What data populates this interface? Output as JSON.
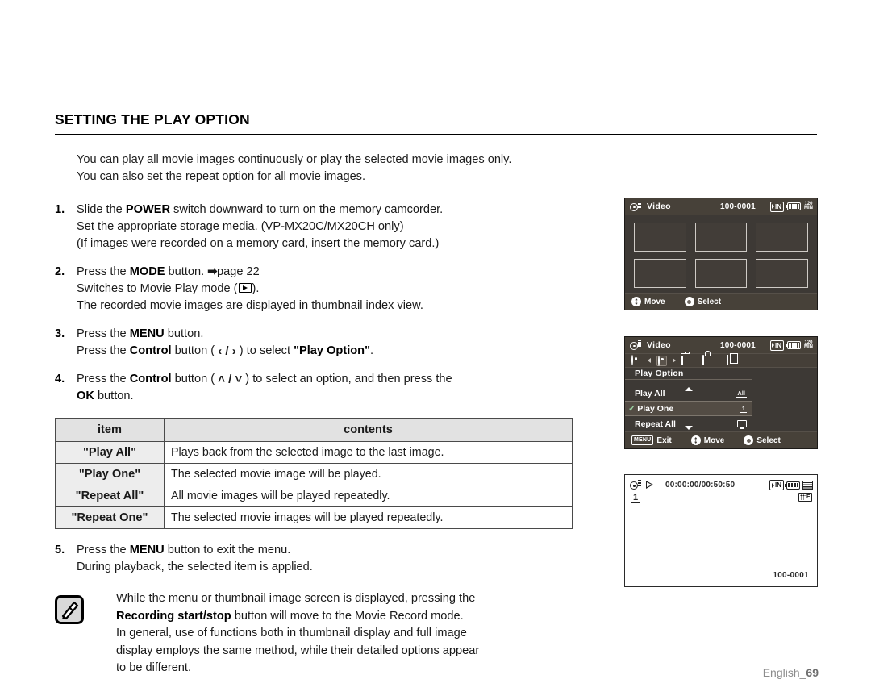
{
  "section": {
    "title": "SETTING THE PLAY OPTION",
    "intro_line1": "You can play all movie images continuously or play the selected movie images only.",
    "intro_line2": "You can also set the repeat option for all movie images."
  },
  "steps": [
    {
      "num": "1.",
      "lead_a": "Slide the ",
      "lead_bold": "POWER",
      "lead_b": " switch downward to turn on the memory camcorder.",
      "sub1": "Set the appropriate storage media. (VP-MX20C/MX20CH only)",
      "sub2": "(If images were recorded on a memory card, insert the memory card.)"
    },
    {
      "num": "2.",
      "lead_a": "Press the ",
      "lead_bold": "MODE",
      "lead_b": " button. ",
      "page_ref": "page 22",
      "sub1_a": "Switches to Movie Play mode (",
      "sub1_b": ").",
      "sub2": "The recorded movie images are displayed in thumbnail index view."
    },
    {
      "num": "3.",
      "lead_a": "Press the ",
      "lead_bold": "MENU",
      "lead_b": " button.",
      "sub1_a": "Press the ",
      "sub1_bold": "Control",
      "sub1_b": " button ( ",
      "sub1_arrows": "‹ / ›",
      "sub1_c": " ) to select ",
      "sub1_target": "\"Play Option\"",
      "sub1_d": "."
    },
    {
      "num": "4.",
      "lead_a": "Press the ",
      "lead_bold": "Control",
      "lead_b": " button ( ",
      "lead_arrows": "˄ / ˅",
      "lead_c": " ) to select an option, and then press the",
      "sub1_bold": "OK",
      "sub1_b": " button."
    }
  ],
  "table": {
    "headers": [
      "item",
      "contents"
    ],
    "rows": [
      {
        "item": "\"Play All\"",
        "contents": "Plays back from the selected image to the last image."
      },
      {
        "item": "\"Play One\"",
        "contents": "The selected movie image will be played."
      },
      {
        "item": "\"Repeat All\"",
        "contents": "All movie images will be played repeatedly."
      },
      {
        "item": "\"Repeat One\"",
        "contents": "The selected movie images will be played repeatedly."
      }
    ]
  },
  "step5": {
    "num": "5.",
    "lead_a": "Press the ",
    "lead_bold": "MENU",
    "lead_b": " button to exit the menu.",
    "sub1": "During playback, the selected item is applied."
  },
  "note": {
    "line1": "While the menu or thumbnail image screen is displayed, pressing the",
    "line2_bold": "Recording start/stop",
    "line2_rest": " button will move to the Movie Record mode.",
    "line3": "In general, use of functions both in thumbnail display and full image",
    "line4": "display employs the same method, while their detailed options appear",
    "line5": "to be different."
  },
  "lcd1": {
    "title": "Video",
    "file_no": "100-0001",
    "storage_badge": "IN",
    "minutes": "120",
    "minutes_unit": "MIN",
    "bottom": {
      "move": "Move",
      "select": "Select"
    },
    "thumb_count": 6
  },
  "lcd2": {
    "title": "Video",
    "file_no": "100-0001",
    "storage_badge": "IN",
    "minutes": "120",
    "minutes_unit": "MIN",
    "menu_header": "Play Option",
    "items": [
      {
        "label": "Play All",
        "value_badge": "All",
        "checked": false,
        "selected": false
      },
      {
        "label": "Play One",
        "value_badge": "1",
        "checked": true,
        "selected": true
      },
      {
        "label": "Repeat All",
        "value_badge": "screen-icon",
        "checked": false,
        "selected": false
      }
    ],
    "bottom": {
      "exit_badge": "MENU",
      "exit": "Exit",
      "move": "Move",
      "select": "Select"
    },
    "tabs": [
      "gear-icon",
      "play-option-icon",
      "trash-icon",
      "lock-icon",
      "copy-icon"
    ]
  },
  "lcd3": {
    "timecode": "00:00:00/00:50:50",
    "storage_badge": "IN",
    "index_label": "1",
    "hdf_badge": "F",
    "file_no": "100-0001"
  },
  "footer": {
    "text": "English_",
    "page": "69"
  },
  "colors": {
    "lcd_bg": "#3d3935",
    "lcd_bar": "#474139",
    "table_header_bg": "#e2e2e2",
    "table_item_bg": "#ededed",
    "footer_text": "#8c8c8c"
  }
}
